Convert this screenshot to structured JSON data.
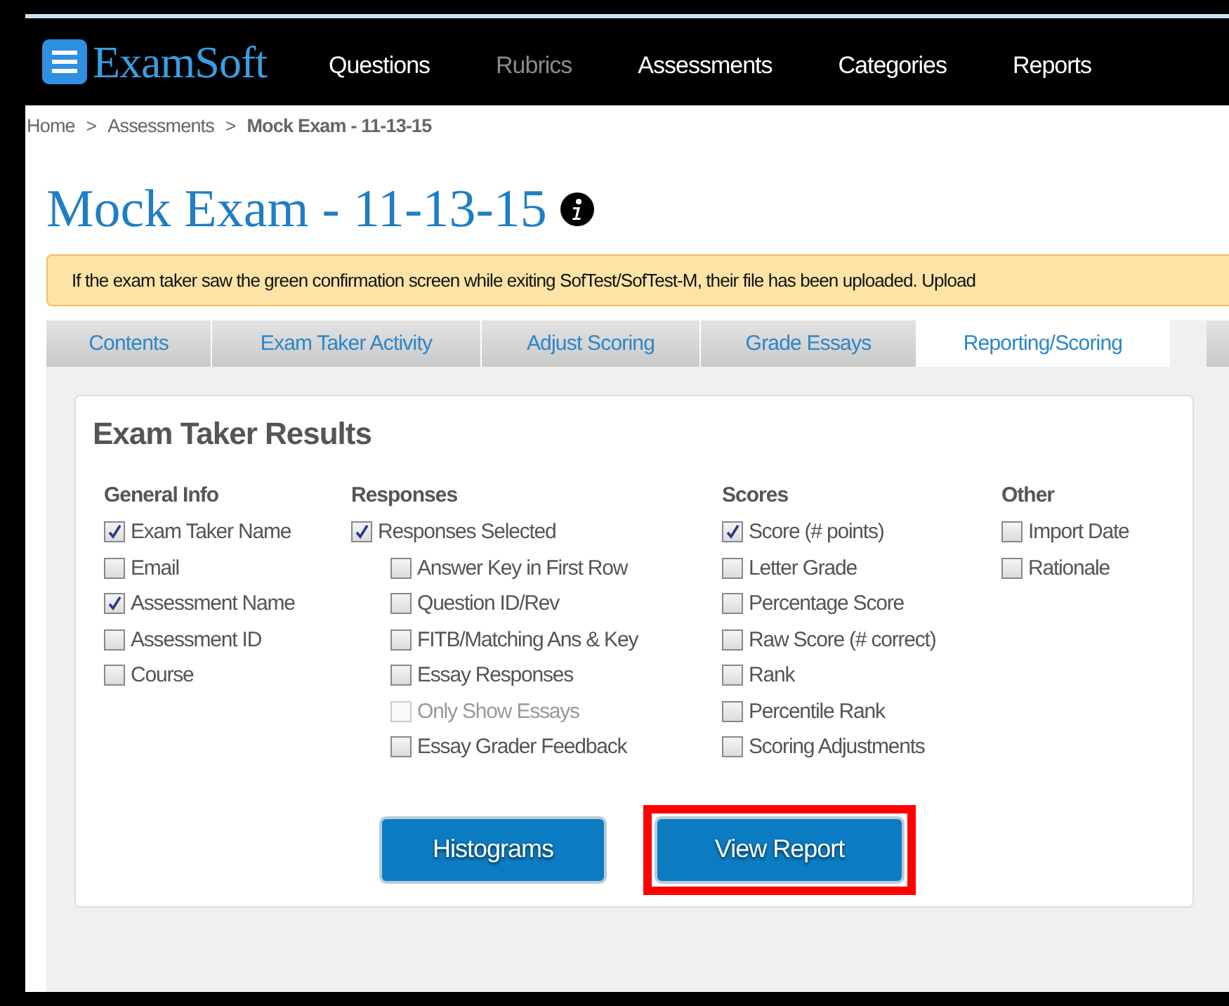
{
  "header": {
    "logo": "ExamSoft",
    "nav": [
      {
        "label": "Questions",
        "disabled": false
      },
      {
        "label": "Rubrics",
        "disabled": true
      },
      {
        "label": "Assessments",
        "disabled": false
      },
      {
        "label": "Categories",
        "disabled": false
      },
      {
        "label": "Reports",
        "disabled": false
      }
    ]
  },
  "breadcrumb": [
    {
      "label": "Home",
      "current": false
    },
    {
      "label": "Assessments",
      "current": false
    },
    {
      "label": "Mock Exam - 11-13-15",
      "current": true
    }
  ],
  "breadcrumb_separator": ">",
  "title": "Mock Exam - 11-13-15",
  "alert": "If the exam taker saw the green confirmation screen while exiting SofTest/SofTest-M, their file has been uploaded. Upload",
  "tabs": [
    {
      "label": "Contents",
      "selected": false
    },
    {
      "label": "Exam Taker Activity",
      "selected": false
    },
    {
      "label": "Adjust Scoring",
      "selected": false
    },
    {
      "label": "Grade Essays",
      "selected": false
    },
    {
      "label": "Reporting/Scoring",
      "selected": true
    }
  ],
  "panel": {
    "title": "Exam Taker Results",
    "groups": [
      {
        "heading": "General Info",
        "options": [
          {
            "label": "Exam Taker Name",
            "checked": true,
            "disabled": false
          },
          {
            "label": "Email",
            "checked": false,
            "disabled": false
          },
          {
            "label": "Assessment Name",
            "checked": true,
            "disabled": false
          },
          {
            "label": "Assessment ID",
            "checked": false,
            "disabled": false
          },
          {
            "label": "Course",
            "checked": false,
            "disabled": false
          }
        ]
      },
      {
        "heading": "Responses",
        "options": [
          {
            "label": "Responses Selected",
            "checked": true,
            "disabled": false,
            "children": [
              {
                "label": "Answer Key in First Row",
                "checked": false,
                "disabled": false
              },
              {
                "label": "Question ID/Rev",
                "checked": false,
                "disabled": false
              },
              {
                "label": "FITB/Matching Ans & Key",
                "checked": false,
                "disabled": false
              },
              {
                "label": "Essay Responses",
                "checked": false,
                "disabled": false
              },
              {
                "label": "Only Show Essays",
                "checked": false,
                "disabled": true
              },
              {
                "label": "Essay Grader Feedback",
                "checked": false,
                "disabled": false
              }
            ]
          }
        ]
      },
      {
        "heading": "Scores",
        "options": [
          {
            "label": "Score (# points)",
            "checked": true,
            "disabled": false
          },
          {
            "label": "Letter Grade",
            "checked": false,
            "disabled": false
          },
          {
            "label": "Percentage Score",
            "checked": false,
            "disabled": false
          },
          {
            "label": "Raw Score (# correct)",
            "checked": false,
            "disabled": false
          },
          {
            "label": "Rank",
            "checked": false,
            "disabled": false
          },
          {
            "label": "Percentile Rank",
            "checked": false,
            "disabled": false
          },
          {
            "label": "Scoring Adjustments",
            "checked": false,
            "disabled": false
          }
        ]
      },
      {
        "heading": "Other",
        "options": [
          {
            "label": "Import Date",
            "checked": false,
            "disabled": false
          },
          {
            "label": "Rationale",
            "checked": false,
            "disabled": false
          }
        ]
      }
    ],
    "buttons": [
      {
        "label": "Histograms",
        "highlighted": false
      },
      {
        "label": "View Report",
        "highlighted": true
      }
    ]
  }
}
